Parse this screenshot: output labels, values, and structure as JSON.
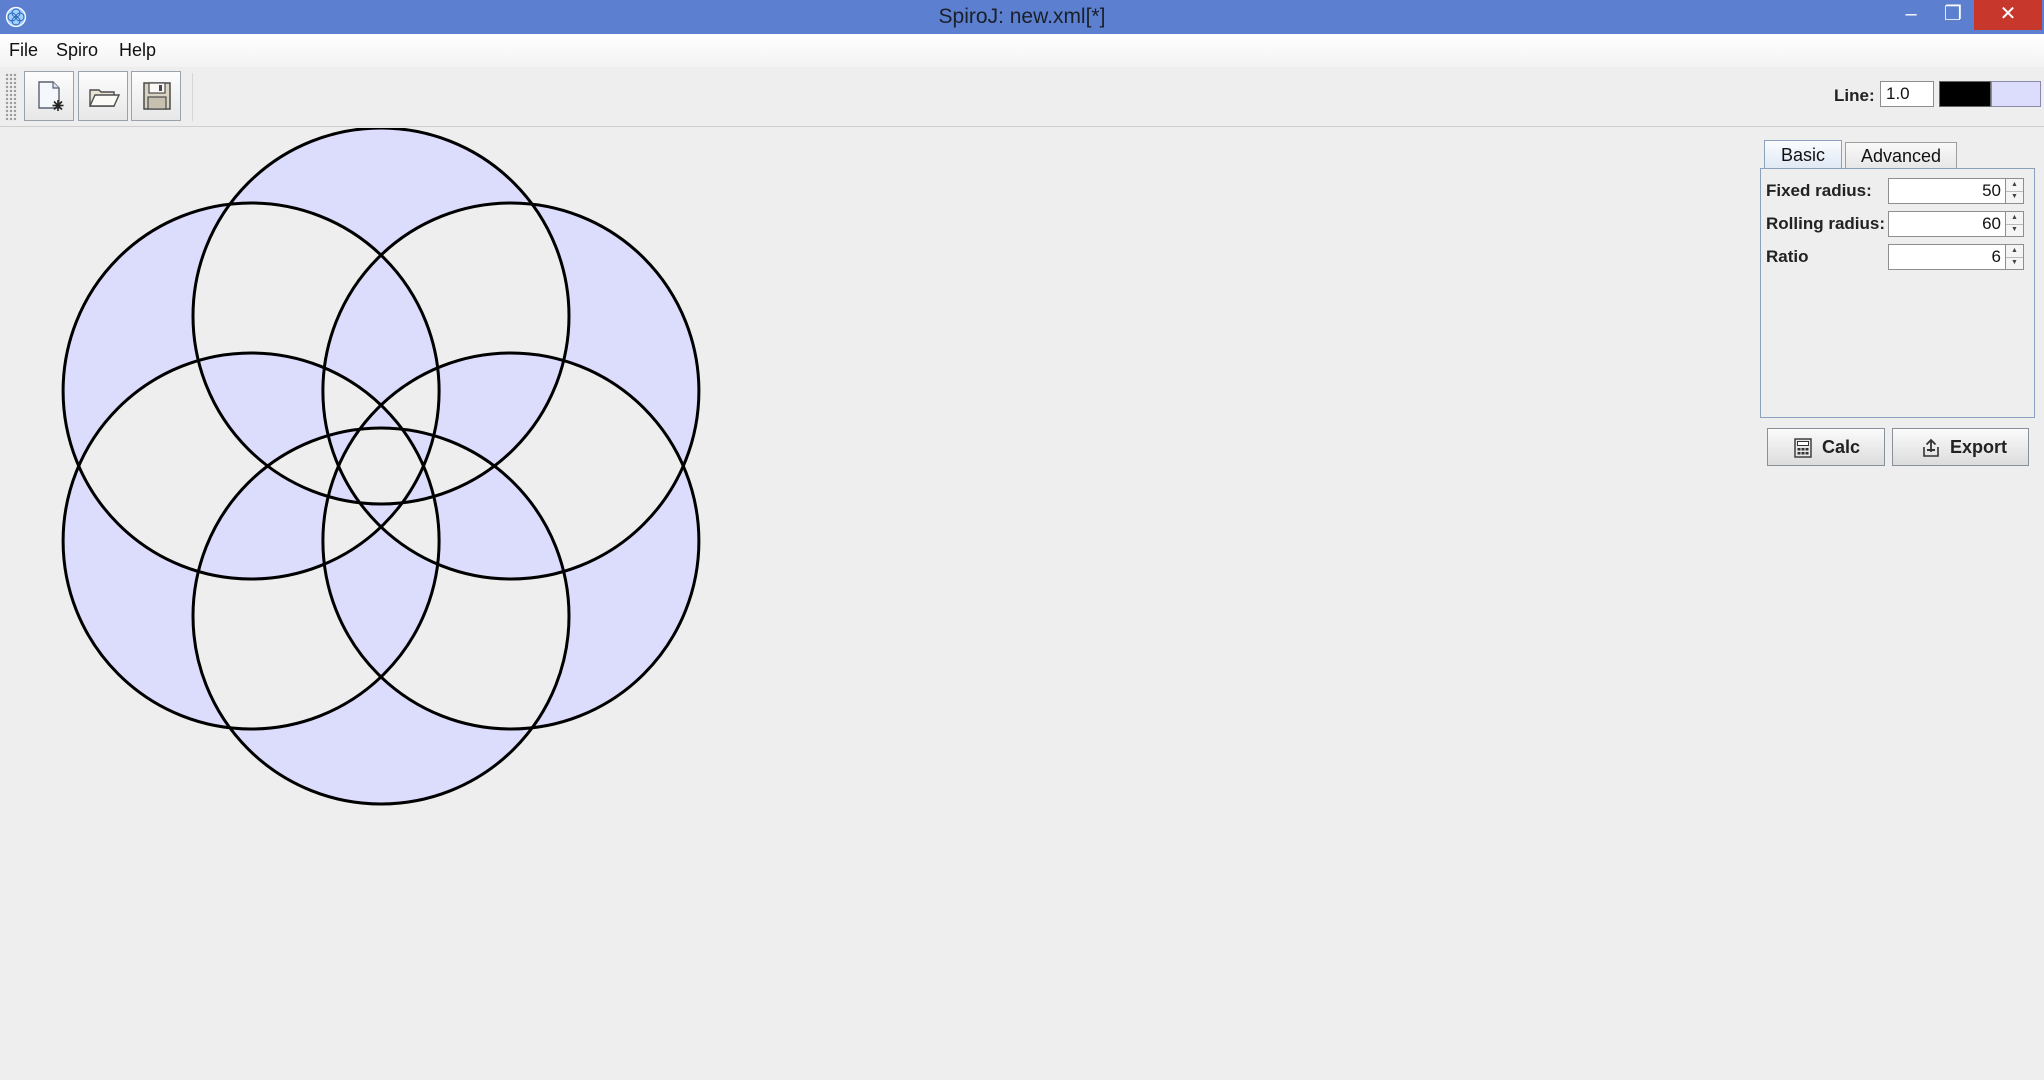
{
  "window": {
    "title": "SpiroJ: new.xml[*]",
    "minimize_glyph": "–",
    "maximize_glyph": "❐",
    "close_glyph": "✕"
  },
  "menu": {
    "file": "File",
    "spiro": "Spiro",
    "help": "Help"
  },
  "toolbar": {
    "buttons": [
      {
        "icon": "new-document-icon"
      },
      {
        "icon": "open-folder-icon"
      },
      {
        "icon": "save-disk-icon"
      }
    ],
    "line_label": "Line:",
    "line_width": "1.0",
    "line_color": "#000000",
    "fill_color": "#dcdcfc"
  },
  "tabs": {
    "basic": "Basic",
    "advanced": "Advanced",
    "active": "Basic"
  },
  "params": {
    "fixed_radius_label": "Fixed radius:",
    "fixed_radius": "50",
    "rolling_radius_label": "Rolling radius:",
    "rolling_radius": "60",
    "ratio_label": "Ratio",
    "ratio": "6"
  },
  "actions": {
    "calc": "Calc",
    "calc_icon": "calculator-icon",
    "export": "Export",
    "export_icon": "export-icon"
  },
  "drawing": {
    "loop_count": 6,
    "stroke_color": "#000000",
    "fill_color": "#dcdcfc",
    "fill_rule": "evenodd"
  }
}
